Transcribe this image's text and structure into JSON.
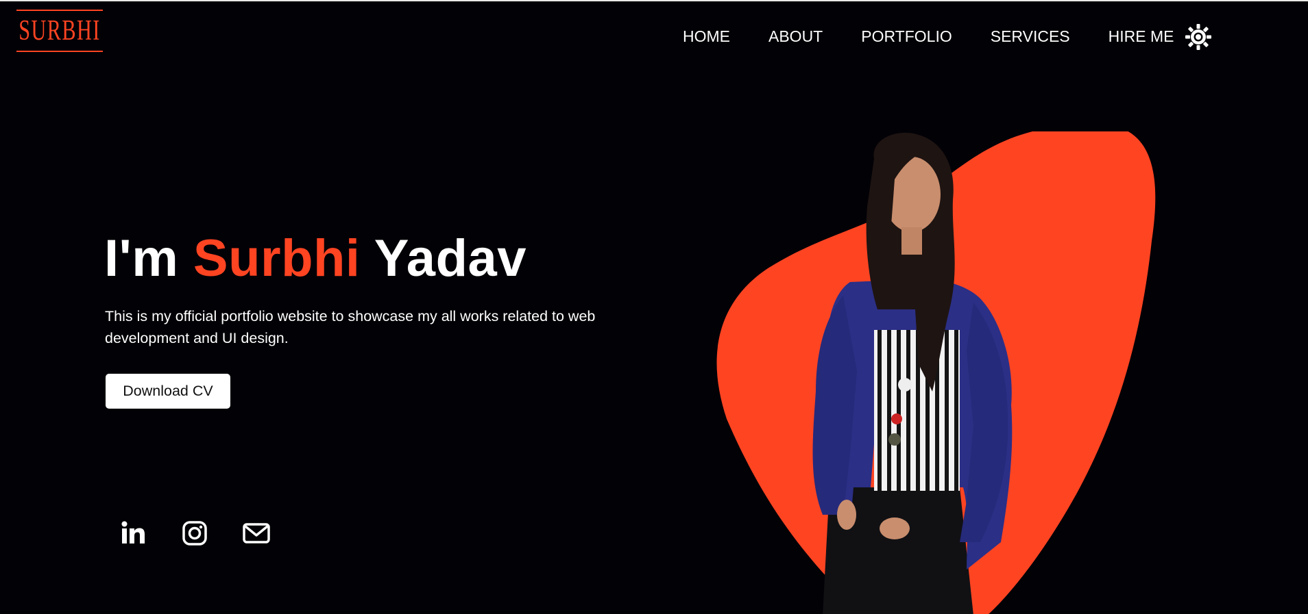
{
  "brand": {
    "logo_text": "SURBHI",
    "accent_color": "#ff4422",
    "background_color": "#020106"
  },
  "nav": {
    "items": [
      {
        "label": "HOME"
      },
      {
        "label": "ABOUT"
      },
      {
        "label": "PORTFOLIO"
      },
      {
        "label": "SERVICES"
      },
      {
        "label": "HIRE ME"
      }
    ],
    "theme_toggle_icon": "sun-icon"
  },
  "hero": {
    "title_prefix": "I'm",
    "title_first_name": "Surbhi",
    "title_last_name": "Yadav",
    "description": "This is my official portfolio website to showcase my all works related to web development and UI design.",
    "download_button": "Download CV"
  },
  "social": {
    "icons": [
      "linkedin-icon",
      "instagram-icon",
      "mail-icon"
    ]
  },
  "portrait": {
    "blob_color": "#ff4422",
    "jacket_color": "#2b2f86"
  }
}
